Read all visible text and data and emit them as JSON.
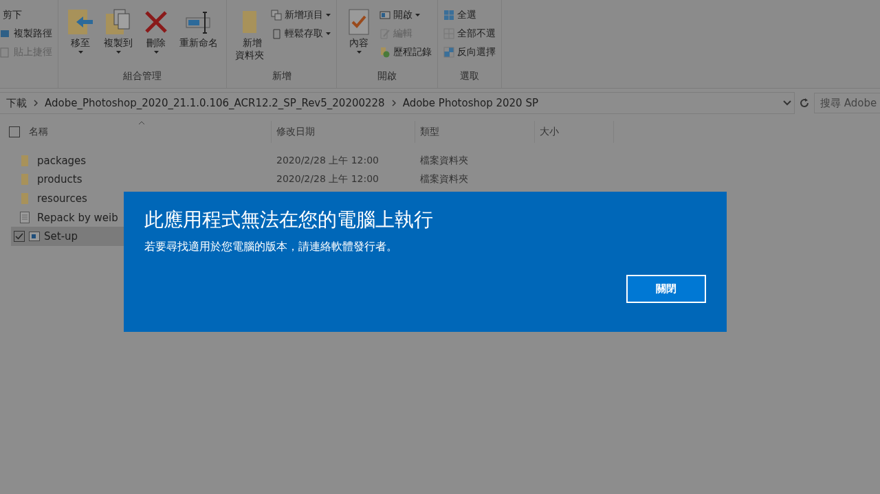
{
  "ribbon": {
    "groups": [
      {
        "commands": [
          {
            "label": "剪下",
            "kind": "small",
            "disabled": false,
            "dropdown": false
          },
          {
            "label": "複製路徑",
            "kind": "small",
            "disabled": false,
            "dropdown": false
          },
          {
            "label": "貼上捷徑",
            "kind": "small",
            "disabled": true,
            "dropdown": false
          }
        ]
      },
      {
        "label": "組合管理",
        "commands": [
          {
            "label": "移至",
            "kind": "large",
            "disabled": false,
            "dropdown": true
          },
          {
            "label": "複製到",
            "kind": "large",
            "disabled": false,
            "dropdown": true
          },
          {
            "label": "刪除",
            "kind": "large",
            "disabled": false,
            "dropdown": true
          },
          {
            "label": "重新命名",
            "kind": "large",
            "disabled": false,
            "dropdown": false
          }
        ]
      },
      {
        "label": "新增",
        "commands": [
          {
            "label": "新增資料夾",
            "kind": "wrapped",
            "disabled": false,
            "dropdown": false
          },
          {
            "label": "新增項目",
            "kind": "small",
            "disabled": false,
            "dropdown": true
          },
          {
            "label": "輕鬆存取",
            "kind": "small",
            "disabled": false,
            "dropdown": true
          }
        ]
      },
      {
        "label": "開啟",
        "commands": [
          {
            "label": "內容",
            "kind": "large",
            "disabled": false,
            "dropdown": true
          },
          {
            "label": "開啟",
            "kind": "small",
            "disabled": false,
            "dropdown": true
          },
          {
            "label": "編輯",
            "kind": "small",
            "disabled": true,
            "dropdown": false
          },
          {
            "label": "歷程記錄",
            "kind": "small",
            "disabled": false,
            "dropdown": false
          }
        ]
      },
      {
        "label": "選取",
        "commands": [
          {
            "label": "全選",
            "kind": "small",
            "disabled": false,
            "dropdown": false
          },
          {
            "label": "全部不選",
            "kind": "small",
            "disabled": false,
            "dropdown": false
          },
          {
            "label": "反向選擇",
            "kind": "small",
            "disabled": false,
            "dropdown": false
          }
        ]
      }
    ]
  },
  "address": {
    "path": [
      "下載",
      "Adobe_Photoshop_2020_21.1.0.106_ACR12.2_SP_Rev5_20200228",
      "Adobe Photoshop 2020 SP"
    ],
    "search_placeholder": "搜尋 Adobe"
  },
  "columns": [
    {
      "label": "名稱",
      "sorted": true
    },
    {
      "label": "修改日期",
      "sorted": false
    },
    {
      "label": "類型",
      "sorted": false
    },
    {
      "label": "大小",
      "sorted": false
    }
  ],
  "select_all_checked": false,
  "files": [
    {
      "name": "packages",
      "kind": "folder",
      "date": "2020/2/28 上午 12:00",
      "type": "檔案資料夾",
      "selected": false,
      "checked": false
    },
    {
      "name": "products",
      "kind": "folder",
      "date": "2020/2/28 上午 12:00",
      "type": "檔案資料夾",
      "selected": false,
      "checked": false
    },
    {
      "name": "resources",
      "kind": "folder",
      "selected": false,
      "checked": false
    },
    {
      "name": "Repack by weib",
      "kind": "document",
      "selected": false,
      "checked": false
    },
    {
      "name": "Set-up",
      "kind": "application",
      "selected": true,
      "checked": true
    }
  ],
  "dialog": {
    "title": "此應用程式無法在您的電腦上執行",
    "message": "若要尋找適用於您電腦的版本，請連絡軟體發行者。",
    "button": "關閉"
  }
}
